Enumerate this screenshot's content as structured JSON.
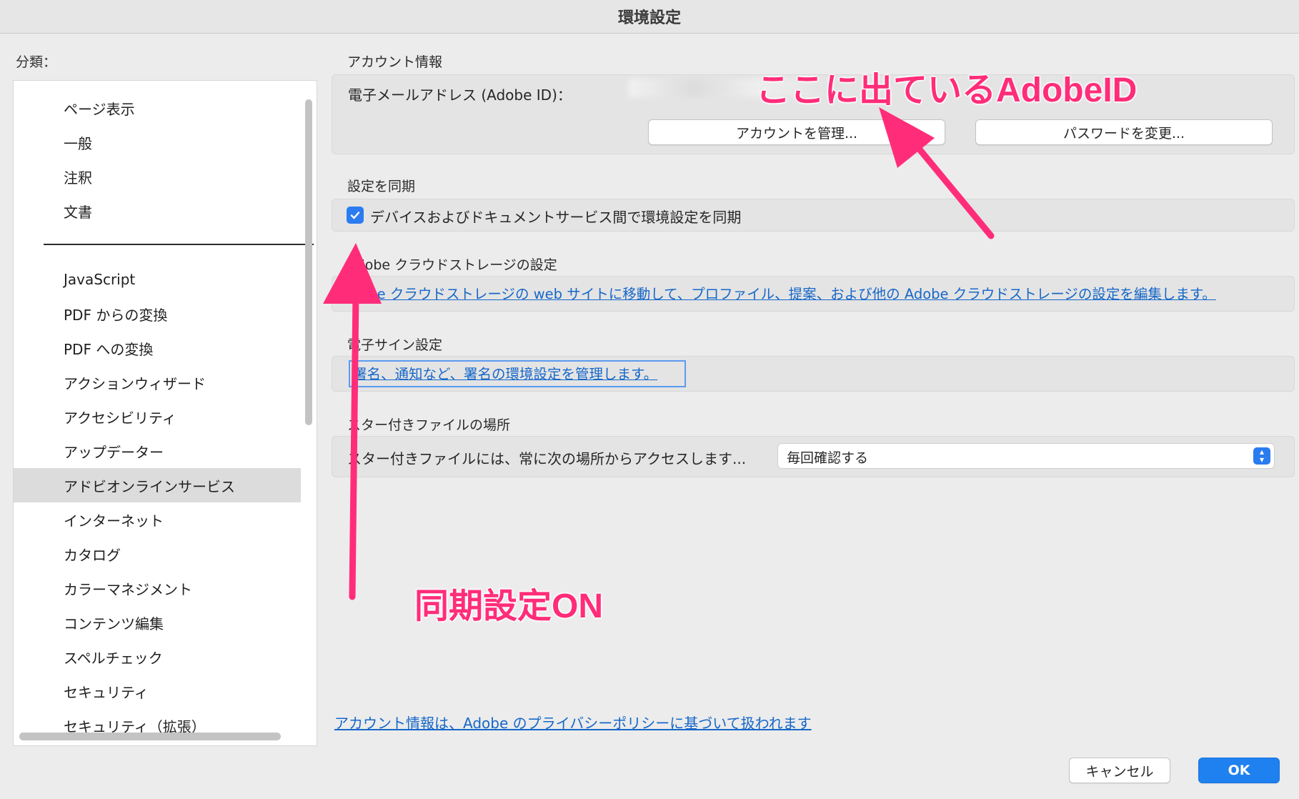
{
  "window": {
    "title": "環境設定"
  },
  "sidebar": {
    "label": "分類：",
    "items": [
      "ページ表示",
      "一般",
      "注釈",
      "文書",
      "JavaScript",
      "PDF からの変換",
      "PDF への変換",
      "アクションウィザード",
      "アクセシビリティ",
      "アップデーター",
      "アドビオンラインサービス",
      "インターネット",
      "カタログ",
      "カラーマネジメント",
      "コンテンツ編集",
      "スペルチェック",
      "セキュリティ",
      "セキュリティ（拡張）"
    ],
    "selected": "アドビオンラインサービス"
  },
  "account": {
    "section_title": "アカウント情報",
    "email_label": "電子メールアドレス (Adobe ID)：",
    "manage_button": "アカウントを管理...",
    "password_button": "パスワードを変更..."
  },
  "sync": {
    "section_title": "設定を同期",
    "checkbox_label": "デバイスおよびドキュメントサービス間で環境設定を同期",
    "checked": true
  },
  "cloud": {
    "section_title": "Adobe クラウドストレージの設定",
    "link_text": "Adobe クラウドストレージの web サイトに移動して、プロファイル、提案、および他の Adobe クラウドストレージの設定を編集します。"
  },
  "esign": {
    "section_title": "電子サイン設定",
    "link_text": "署名、通知など、署名の環境設定を管理します。"
  },
  "starred": {
    "section_title": "スター付きファイルの場所",
    "label": "スター付きファイルには、常に次の場所からアクセスします...",
    "select_value": "毎回確認する"
  },
  "privacy_link": "アカウント情報は、Adobe のプライバシーポリシーに基づいて扱われます",
  "footer": {
    "cancel": "キャンセル",
    "ok": "OK"
  },
  "annotations": {
    "adobe_id": "ここに出ているAdobeID",
    "sync_on": "同期設定ON",
    "color": "#ff2d79"
  },
  "colors": {
    "accent": "#1f80f0",
    "link": "#1667c8",
    "selection": "#dcdcdc"
  }
}
